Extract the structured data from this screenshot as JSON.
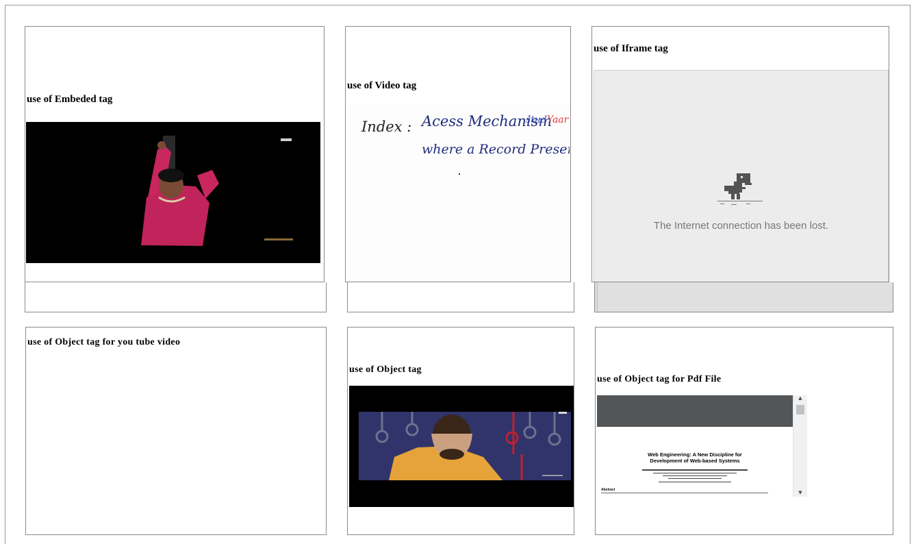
{
  "cells": {
    "embed": {
      "heading": "use of Embeded tag"
    },
    "video": {
      "heading": "use of Video tag",
      "board_line1_label": "Index :",
      "board_line1_text": "Acess Mechanism",
      "board_line2_text": "where a Record Present",
      "brand_part1": "stud",
      "brand_part2": "Yaar"
    },
    "iframe": {
      "heading": "use of Iframe tag",
      "offline_message": "The Internet connection has been lost."
    },
    "object_youtube": {
      "heading": "use of Object tag for you tube video"
    },
    "object": {
      "heading": "use of Object tag"
    },
    "object_pdf": {
      "heading": "use of Object tag for Pdf File",
      "pdf_title": "Web Engineering: A New Discipline for Development of Web-based Systems",
      "pdf_section": "Abstract"
    }
  },
  "colors": {
    "brand_blue": "#3b5bc4",
    "brand_red": "#e03a3a",
    "ink": "#1f2b7a"
  }
}
